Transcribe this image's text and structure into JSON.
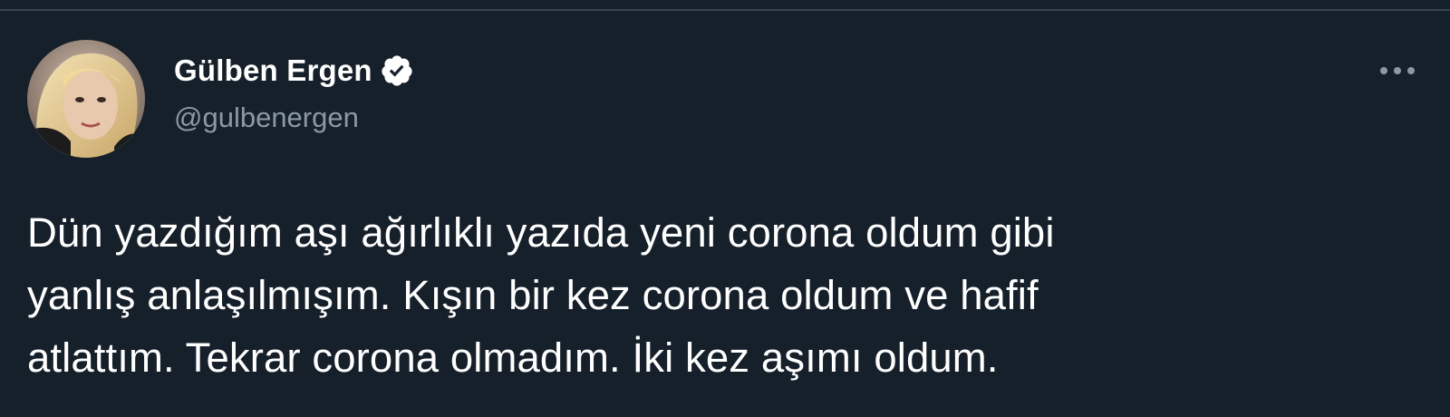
{
  "tweet": {
    "author": {
      "display_name": "Gülben Ergen",
      "handle": "@gulbenergen",
      "verified": true,
      "avatar_icon": "profile-photo"
    },
    "more_icon": "more-horizontal-icon",
    "text_lines": [
      "Dün yazdığım aşı ağırlıklı yazıda yeni corona oldum gibi",
      "yanlış anlaşılmışım. Kışın bir kez corona oldum ve hafif",
      "atlattım. Tekrar corona olmadım. İki kez aşımı oldum."
    ]
  },
  "colors": {
    "background": "#15202b",
    "text_primary": "#ffffff",
    "text_secondary": "#8b98a5",
    "divider": "#38444d"
  }
}
